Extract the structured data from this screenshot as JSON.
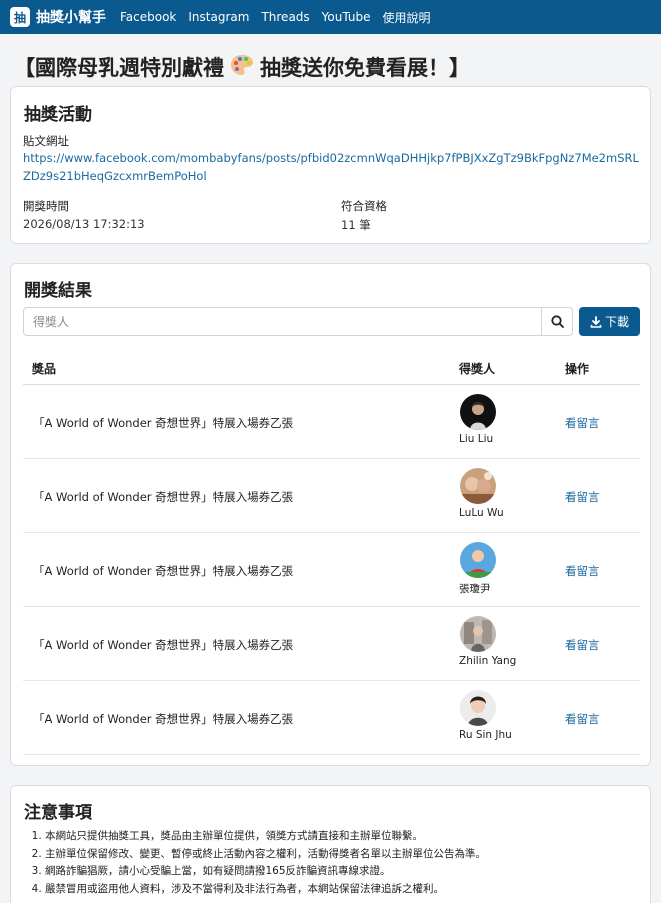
{
  "nav": {
    "logo_char": "抽",
    "brand": "抽獎小幫手",
    "links": [
      "Facebook",
      "Instagram",
      "Threads",
      "YouTube",
      "使用說明"
    ]
  },
  "page": {
    "title_left": "【國際母乳週特別獻禮",
    "title_right": "抽獎送你免費看展！】"
  },
  "activity": {
    "heading": "抽獎活動",
    "post_url_label": "貼文網址",
    "post_url": "https://www.facebook.com/mombabyfans/posts/pfbid02zcmnWqaDHHjkp7fPBJXxZgTz9BkFpgNz7Me2mSRLZDz9s21bHeqGzcxmrBemPoHol",
    "draw_time_label": "開獎時間",
    "draw_time": "2026/08/13 17:32:13",
    "eligible_label": "符合資格",
    "eligible_count": "11 筆"
  },
  "results": {
    "heading": "開獎結果",
    "search_placeholder": "得獎人",
    "download_label": "下載",
    "columns": {
      "prize": "獎品",
      "winner": "得獎人",
      "action": "操作"
    },
    "rows": [
      {
        "prize": "「A World of Wonder 奇想世界」特展入場券乙張",
        "winner": "Liu Liu",
        "action": "看留言"
      },
      {
        "prize": "「A World of Wonder 奇想世界」特展入場券乙張",
        "winner": "LuLu Wu",
        "action": "看留言"
      },
      {
        "prize": "「A World of Wonder 奇想世界」特展入場券乙張",
        "winner": "張瓊尹",
        "action": "看留言"
      },
      {
        "prize": "「A World of Wonder 奇想世界」特展入場券乙張",
        "winner": "Zhilin Yang",
        "action": "看留言"
      },
      {
        "prize": "「A World of Wonder 奇想世界」特展入場券乙張",
        "winner": "Ru Sin Jhu",
        "action": "看留言"
      }
    ]
  },
  "notes": {
    "heading": "注意事項",
    "items": [
      "本網站只提供抽獎工具，獎品由主辦單位提供，領獎方式請直接和主辦單位聯繫。",
      "主辦單位保留修改、變更、暫停或終止活動內容之權利，活動得獎者名單以主辦單位公告為準。",
      "網路詐騙猖厥，請小心受騙上當，如有疑問請撥165反詐騙資訊專線求證。",
      "嚴禁冒用或盜用他人資料，涉及不當得利及非法行為者，本網站保留法律追訴之權利。"
    ]
  },
  "colors": {
    "primary": "#0b5a8f",
    "link": "#1a6aa0",
    "background": "#f3f4f6"
  }
}
